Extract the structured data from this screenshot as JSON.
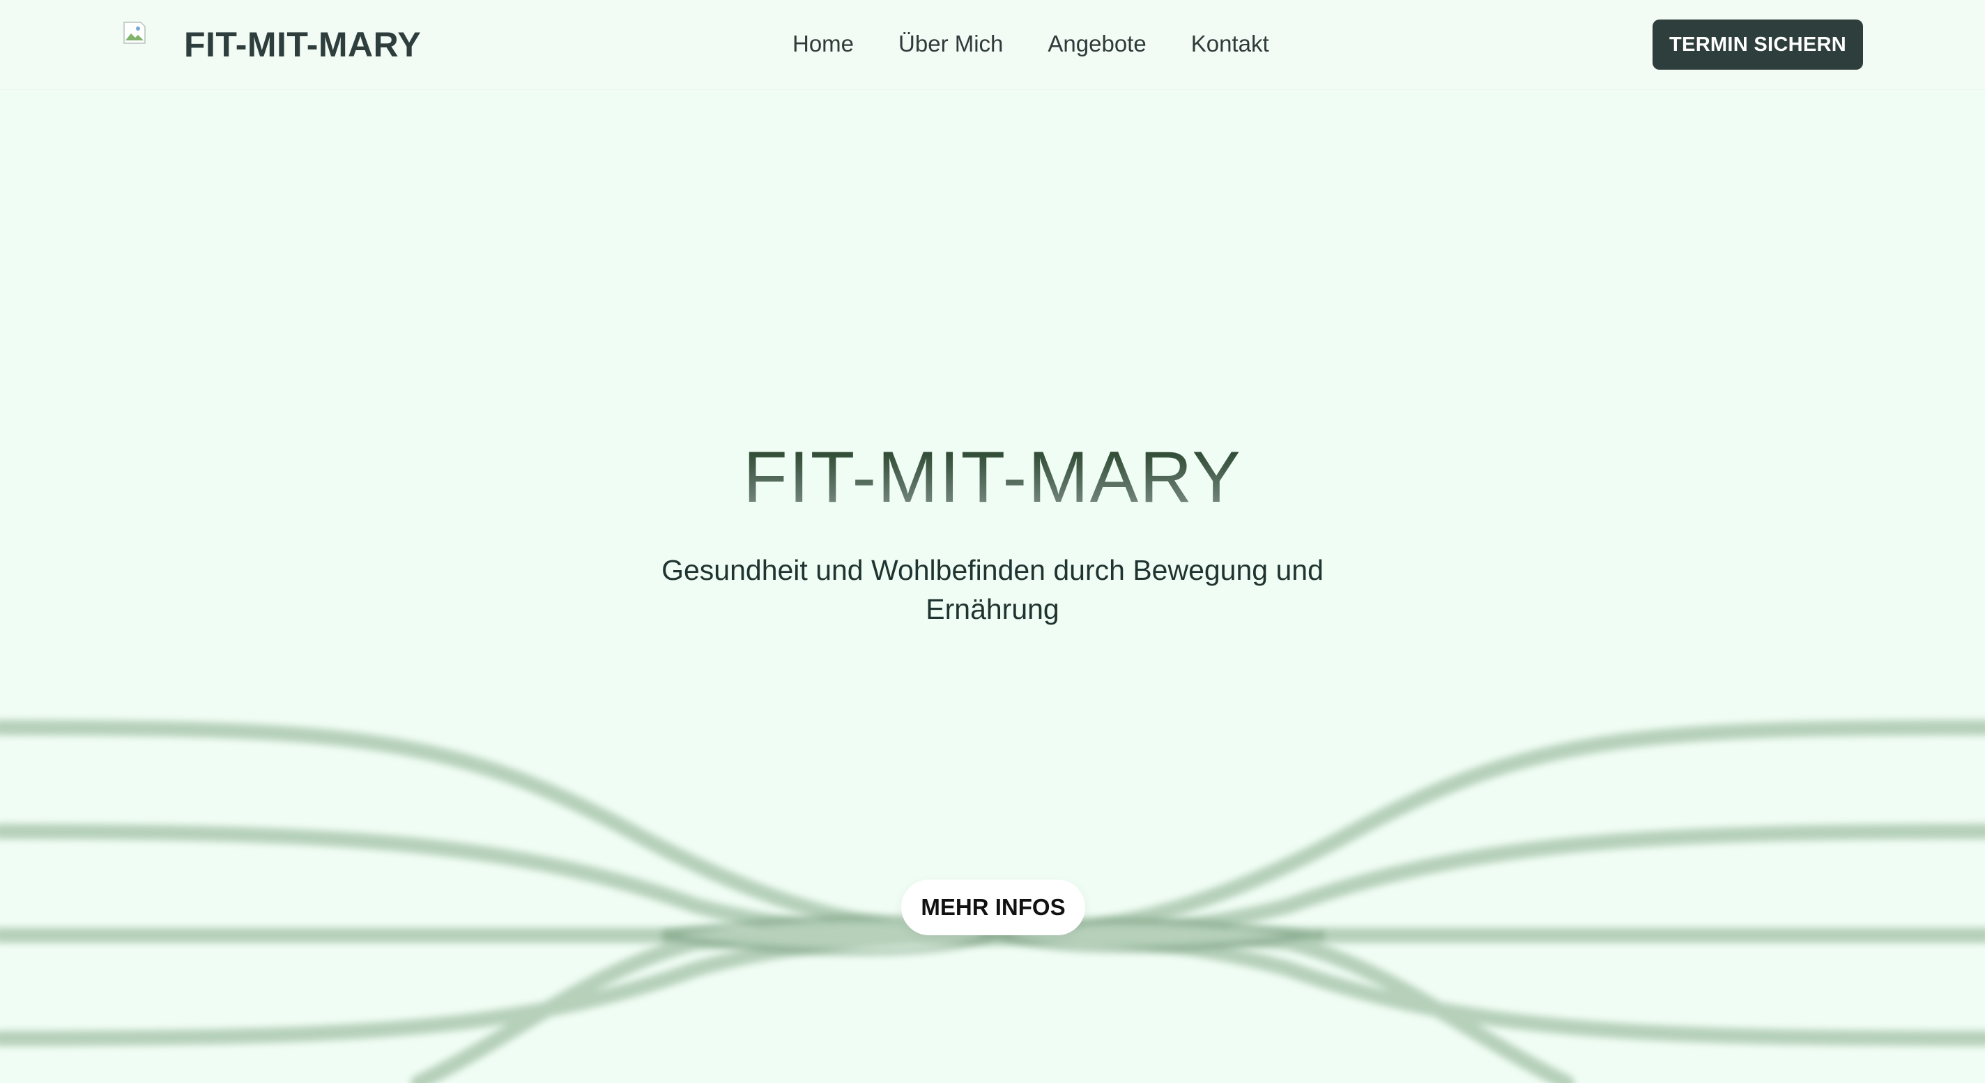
{
  "header": {
    "logo_icon": "broken-image-icon",
    "brand": "FIT-MIT-MARY",
    "nav": [
      "Home",
      "Über Mich",
      "Angebote",
      "Kontakt"
    ],
    "cta_label": "TERMIN SICHERN"
  },
  "hero": {
    "title": "FIT-MIT-MARY",
    "subtitle": "Gesundheit und Wohlbefinden durch Bewegung und Ernährung",
    "button_label": "MEHR INFOS"
  },
  "colors": {
    "background": "#f0fdf4",
    "header_background": "#f3fbf5",
    "brand_dark": "#2d3e3c",
    "wave_green": "#6f9a74",
    "button_light": "#ffffff"
  }
}
